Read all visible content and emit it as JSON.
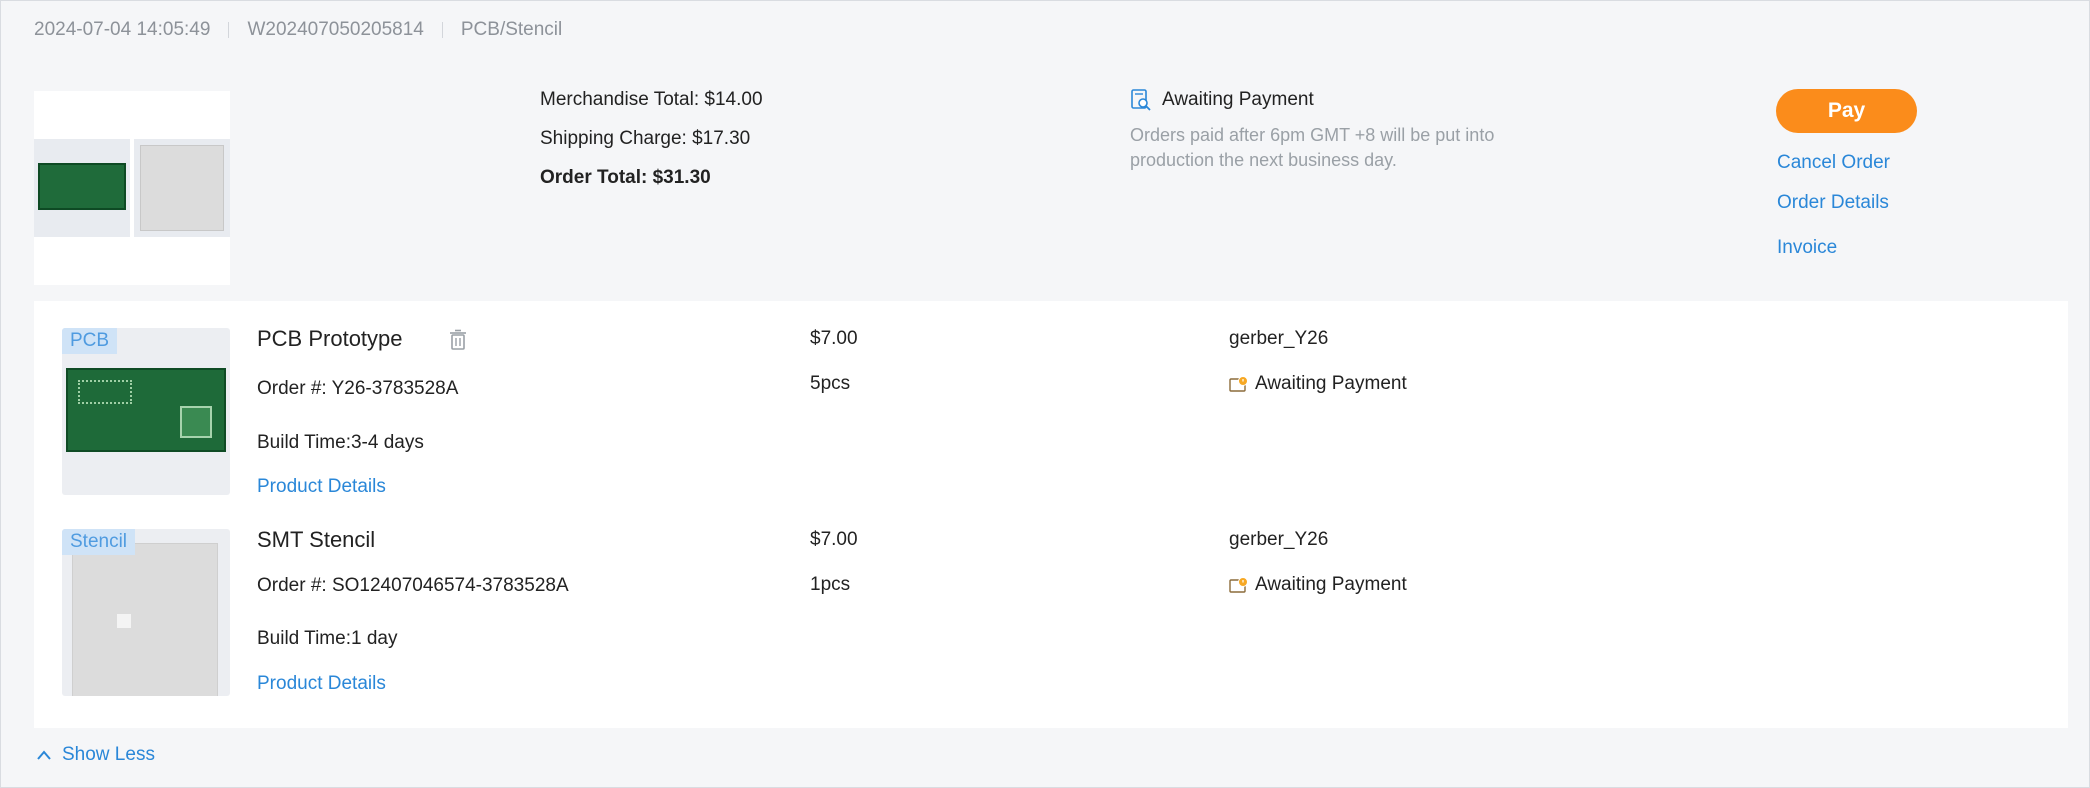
{
  "header": {
    "date": "2024-07-04 14:05:49",
    "order_id": "W202407050205814",
    "category": "PCB/Stencil"
  },
  "summary": {
    "merchandise_total": "Merchandise Total: $14.00",
    "shipping_charge": "Shipping Charge: $17.30",
    "order_total": "Order Total: $31.30",
    "status": "Awaiting Payment",
    "status_note": "Orders paid after 6pm GMT +8 will be put into production the next business day."
  },
  "actions": {
    "pay": "Pay",
    "cancel": "Cancel Order",
    "details": "Order Details",
    "invoice": "Invoice"
  },
  "items": [
    {
      "tag": "PCB",
      "name": "PCB Prototype",
      "order_no": "Order #: Y26-3783528A",
      "build_time": "Build Time:3-4 days",
      "link": "Product Details",
      "price": "$7.00",
      "qty": "5pcs",
      "file": "gerber_Y26",
      "status": "Awaiting Payment"
    },
    {
      "tag": "Stencil",
      "name": "SMT Stencil",
      "order_no": "Order #: SO12407046574-3783528A",
      "build_time": "Build Time:1 day",
      "link": "Product Details",
      "price": "$7.00",
      "qty": "1pcs",
      "file": "gerber_Y26",
      "status": "Awaiting Payment"
    }
  ],
  "footer": {
    "show_less": "Show Less"
  },
  "colors": {
    "accent": "#2a87d8",
    "pay_button": "#fb8c1b",
    "muted_text": "#9aa0a6",
    "card_bg": "#f5f6f8"
  },
  "icons": {
    "status_summary": "document-search-icon",
    "status_item": "wallet-clock-icon",
    "delete": "trash-icon",
    "collapse": "chevron-up-icon"
  }
}
